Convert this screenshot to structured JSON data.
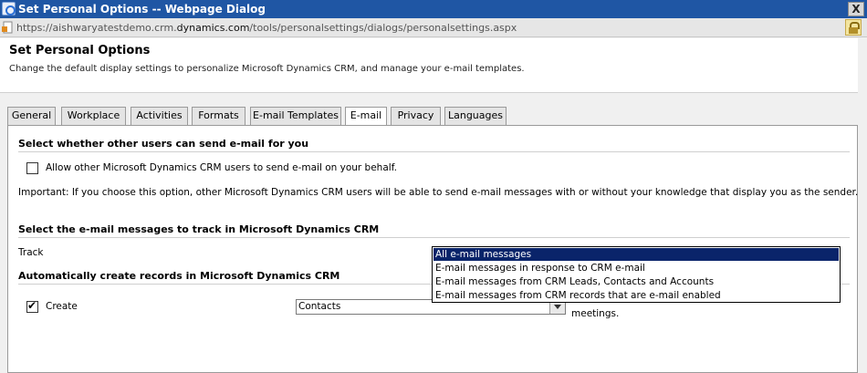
{
  "window": {
    "title": "Set Personal Options -- Webpage Dialog",
    "close_glyph": "X"
  },
  "address": {
    "scheme": "https://",
    "host_prefix": "aishwaryatestdemo.crm.",
    "host": "dynamics.com",
    "path": "/tools/personalsettings/dialogs/personalsettings.aspx"
  },
  "header": {
    "title": "Set Personal Options",
    "description": "Change the default display settings to personalize Microsoft Dynamics CRM, and manage your e-mail templates."
  },
  "tabs": [
    {
      "label": "General"
    },
    {
      "label": "Workplace"
    },
    {
      "label": "Activities"
    },
    {
      "label": "Formats"
    },
    {
      "label": "E-mail Templates"
    },
    {
      "label": "E-mail"
    },
    {
      "label": "Privacy"
    },
    {
      "label": "Languages"
    }
  ],
  "active_tab": "E-mail",
  "email": {
    "section1_title": "Select whether other users can send e-mail for you",
    "allow_label": "Allow other Microsoft Dynamics CRM users to send e-mail on your behalf.",
    "allow_checked": false,
    "important_text": "Important: If you choose this option, other Microsoft Dynamics CRM users will be able to send e-mail messages with or without your knowledge that display you as the sender.",
    "section2_title": "Select the e-mail messages to track in Microsoft Dynamics CRM",
    "track_label": "Track",
    "track_options": [
      "All e-mail messages",
      "E-mail messages in response to CRM e-mail",
      "E-mail messages from CRM Leads, Contacts and Accounts",
      "E-mail messages from CRM records that are e-mail enabled"
    ],
    "track_selected": "All e-mail messages",
    "section3_title": "Automatically create records in Microsoft Dynamics CRM",
    "create_label": "Create",
    "create_checked": true,
    "create_value": "Contacts",
    "create_note_tail": "meetings."
  },
  "colors": {
    "titlebar": "#1f56a4",
    "selected_option": "#0a246a"
  }
}
